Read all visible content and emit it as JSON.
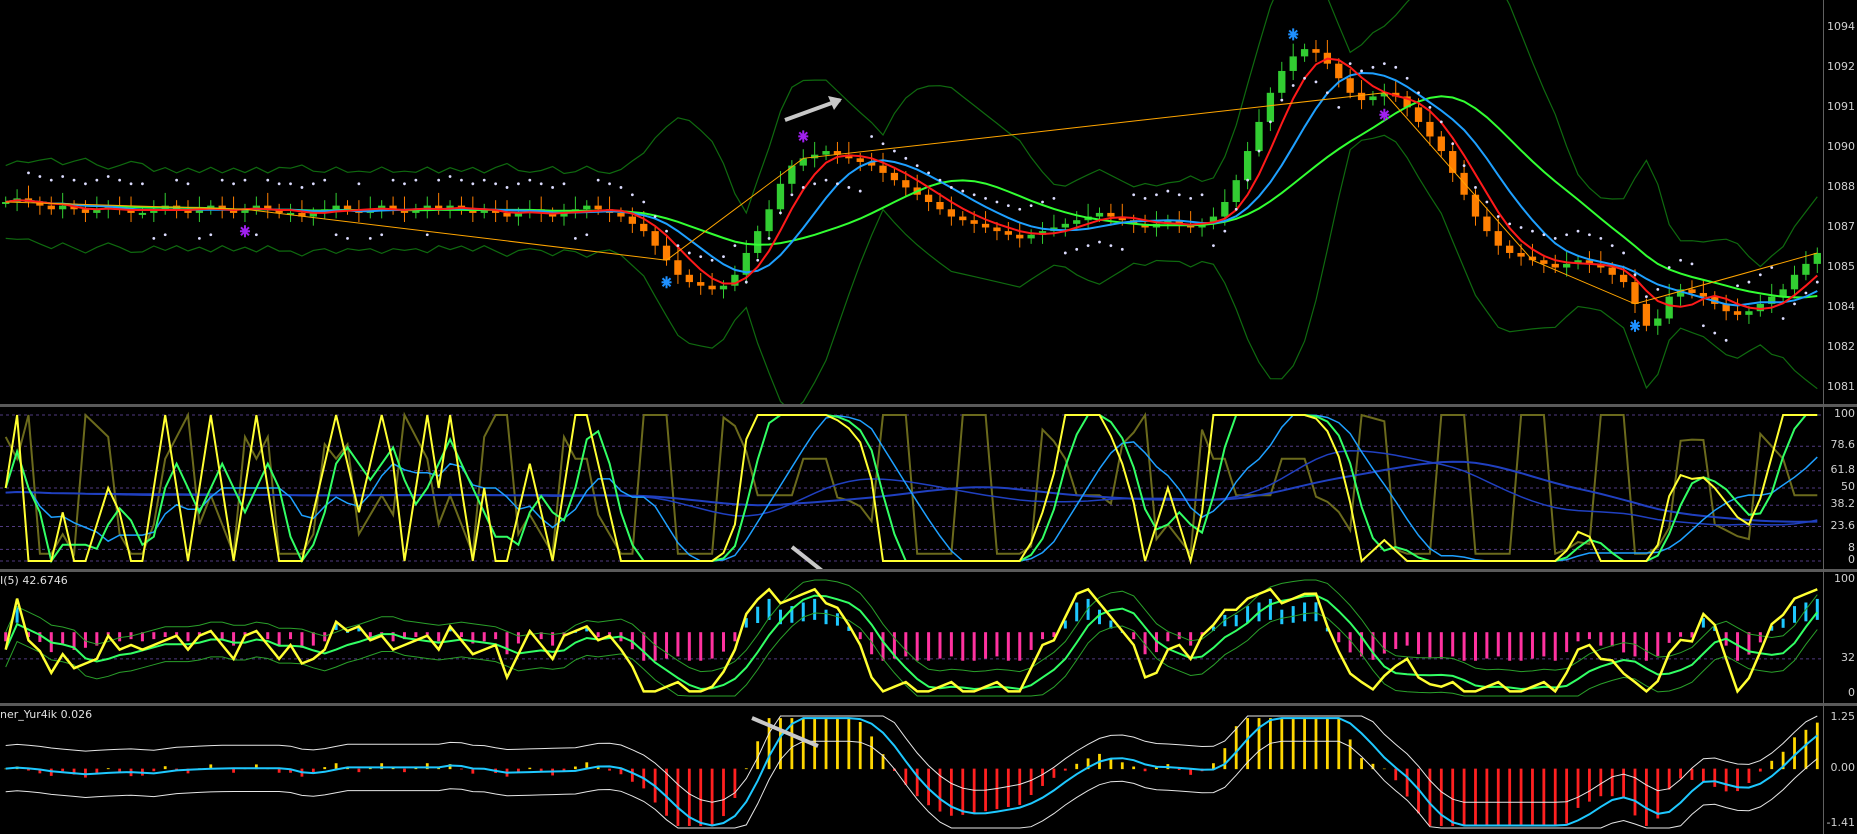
{
  "chart_data": [
    {
      "type": "line",
      "pane": "price",
      "title": "",
      "price_ticks": [
        "1094",
        "1092",
        "1091",
        "1090",
        "1088",
        "1087",
        "1085",
        "1084",
        "1082",
        "1081"
      ],
      "candles_close_relative": [
        50,
        51,
        50,
        49,
        48,
        49,
        48,
        47,
        48,
        49,
        48,
        47,
        47,
        48,
        49,
        48,
        47,
        48,
        49,
        48,
        47,
        48,
        49,
        48,
        47,
        47,
        46,
        47,
        48,
        49,
        48,
        47,
        48,
        49,
        48,
        47,
        48,
        49,
        48,
        49,
        48,
        47,
        48,
        47,
        46,
        47,
        48,
        47,
        46,
        47,
        48,
        49,
        48,
        47,
        46,
        44,
        42,
        38,
        34,
        30,
        28,
        27,
        26,
        27,
        30,
        36,
        42,
        48,
        55,
        60,
        62,
        63,
        64,
        63,
        62,
        61,
        60,
        58,
        56,
        54,
        52,
        50,
        48,
        46,
        45,
        44,
        43,
        42,
        41,
        40,
        41,
        42,
        43,
        44,
        45,
        46,
        47,
        46,
        45,
        44,
        43,
        44,
        45,
        44,
        43,
        44,
        46,
        50,
        56,
        64,
        72,
        80,
        86,
        90,
        92,
        91,
        88,
        84,
        80,
        78,
        79,
        80,
        79,
        76,
        72,
        68,
        64,
        58,
        52,
        46,
        42,
        38,
        36,
        35,
        34,
        33,
        32,
        33,
        34,
        33,
        32,
        30,
        28,
        22,
        16,
        18,
        24,
        26,
        25,
        24,
        22,
        20,
        19,
        20,
        22,
        24,
        26,
        30,
        33,
        36
      ],
      "zigzag_points": [
        "swing-high",
        "swing-low",
        "swing-high",
        "swing-high",
        "swing-low",
        "swing-high",
        "swing-low"
      ],
      "colors": {
        "bull": "#32cd32",
        "bear": "#ff7f00",
        "ma_fast": "#ff1a1a",
        "ma_mid": "#1ea0ff",
        "ma_slow": "#32ff32",
        "band": "#0f6a0f",
        "psar": "#dcdcff",
        "zigzag": "#ffa500",
        "arrow_up": "#1e90ff",
        "arrow_dn": "#a020f0"
      }
    },
    {
      "type": "line",
      "pane": "stochastic",
      "levels": [
        "100",
        "78.6",
        "61.8",
        "50",
        "38.2",
        "23.6",
        "8",
        "0"
      ],
      "colors": {
        "main": "#ffff32",
        "signal": "#32ff64",
        "fast": "#1ea0ff",
        "slow": "#2040c0",
        "khaki": "#6b6a1c",
        "level": "#503a80"
      }
    },
    {
      "type": "bar",
      "pane": "rsi",
      "label": "I(5) 42.6746",
      "levels": [
        "100",
        "32",
        "0"
      ],
      "colors": {
        "line": "#ffff32",
        "signal": "#32ff64",
        "band": "#2aa02a",
        "hist_pos": "#1ec8ff",
        "hist_neg": "#ff32a0"
      }
    },
    {
      "type": "bar",
      "pane": "oscillator",
      "label": "ner_Yur4ik 0.026",
      "levels": [
        "1.25",
        "0.00",
        "-1.41"
      ],
      "colors": {
        "hist_pos": "#ffd700",
        "hist_neg": "#ff2020",
        "line": "#1ec8ff",
        "band": "#e6e6e6"
      }
    }
  ]
}
